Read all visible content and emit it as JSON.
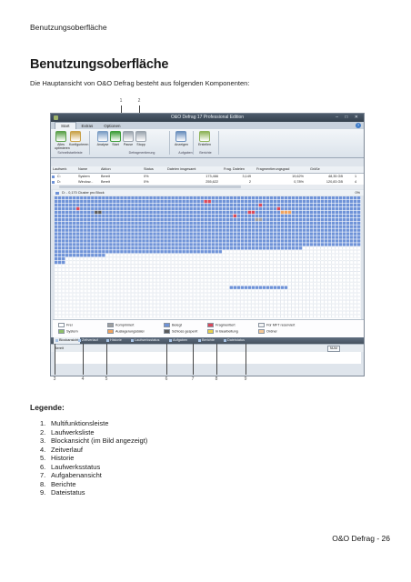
{
  "page_header": "Benutzungsoberfläche",
  "title": "Benutzungsoberfläche",
  "intro": "Die Hauptansicht von O&O Defrag besteht aus folgenden Komponenten:",
  "legend_title": "Legende:",
  "legend_items": [
    {
      "num": "1.",
      "label": "Multifunktionsleiste"
    },
    {
      "num": "2.",
      "label": "Laufwerksliste"
    },
    {
      "num": "3.",
      "label": "Blockansicht (im Bild angezeigt)"
    },
    {
      "num": "4.",
      "label": "Zeitverlauf"
    },
    {
      "num": "5.",
      "label": "Historie"
    },
    {
      "num": "6.",
      "label": "Laufwerksstatus"
    },
    {
      "num": "7.",
      "label": "Aufgabenansicht"
    },
    {
      "num": "8.",
      "label": "Berichte"
    },
    {
      "num": "9.",
      "label": "Dateistatus"
    }
  ],
  "footer": "O&O Defrag - 26",
  "callouts_top": [
    "1",
    "2"
  ],
  "callouts_bottom": [
    "3",
    "4",
    "5",
    "6",
    "7",
    "8",
    "9"
  ],
  "app": {
    "window_title": "O&O Defrag 17 Professional Edition",
    "window_controls": "– □ ✕",
    "help": "?",
    "tabs": [
      "Start",
      "Extras",
      "Optionen"
    ],
    "ribbon_buttons": [
      {
        "label": "Alles optimieren",
        "color": "#5aa04a"
      },
      {
        "label": "Konfigurieren",
        "color": "#c9a24a"
      },
      {
        "label": "Analyse",
        "color": "#7a9cc4"
      },
      {
        "label": "Start",
        "color": "#3e9e3a"
      },
      {
        "label": "Pause",
        "color": "#9aa3ad"
      },
      {
        "label": "Stopp",
        "color": "#9aa3ad"
      },
      {
        "label": "Anzeigen",
        "color": "#6a8fbd"
      },
      {
        "label": "Erstellen",
        "color": "#8fb45a"
      }
    ],
    "ribbon_groups": [
      "Schnellstartleiste",
      "Defragmentierung",
      "Aufgaben",
      "Berichte"
    ],
    "drive_columns": [
      "Laufwerk",
      "Name",
      "Aktion",
      "Status",
      "Dateien insgesamt",
      "Frag. Dateien",
      "Fragmentierungsgrad",
      "Größe"
    ],
    "drives": [
      {
        "drive": "C:",
        "name": "System",
        "action": "Bereit",
        "status": "0%",
        "files": "173,466",
        "frag": "3,149",
        "degree": "19,62%",
        "size": "48,35 GB",
        "extra": "1"
      },
      {
        "drive": "D:",
        "name": "Window...",
        "action": "Bereit",
        "status": "0%",
        "files": "255,622",
        "frag": "2",
        "degree": "0,78%",
        "size": "120,83 GB",
        "extra": "4"
      }
    ],
    "cluster_header": "D: - 0,170 Cluster pro Block",
    "cluster_percent": "0%",
    "color_legend": [
      {
        "label": "Frei",
        "color": "#ffffff"
      },
      {
        "label": "Komprimiert",
        "color": "#9e9e9e"
      },
      {
        "label": "Belegt",
        "color": "#6f93d8"
      },
      {
        "label": "Fragmentiert",
        "color": "#d9485a"
      },
      {
        "label": "Für MFT reserviert",
        "color": "#f4f4f4"
      },
      {
        "label": "System",
        "color": "#8fc06a"
      },
      {
        "label": "Auslagerungsdatei",
        "color": "#f0a35e"
      },
      {
        "label": "Schloss gesperrt",
        "color": "#5a5a5a"
      },
      {
        "label": "In Bearbeitung",
        "color": "#e8d04b"
      },
      {
        "label": "Ordner",
        "color": "#f6c896"
      }
    ],
    "bottom_tabs": [
      "Blockansicht",
      "Zeitverlauf",
      "Historie",
      "Laufwerksstatus",
      "Aufgaben",
      "Berichte",
      "Dateistatus"
    ],
    "status_text": "Bereit",
    "status_mode": "NUM"
  }
}
